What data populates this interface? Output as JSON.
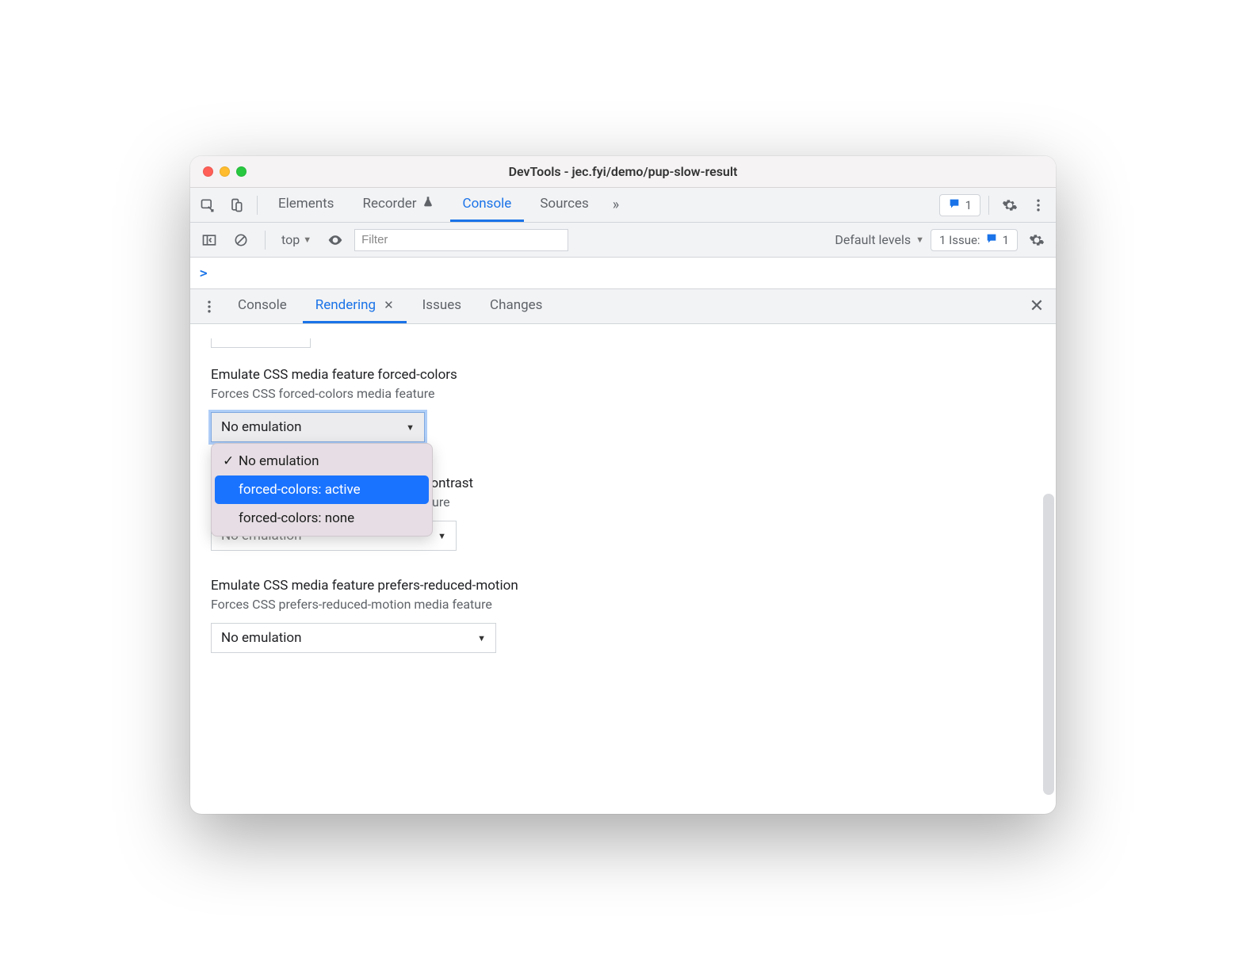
{
  "window": {
    "title": "DevTools - jec.fyi/demo/pup-slow-result"
  },
  "main_tabs": {
    "elements": "Elements",
    "recorder": "Recorder",
    "console": "Console",
    "sources": "Sources"
  },
  "issue_badge": {
    "count": "1"
  },
  "console_toolbar": {
    "context": "top",
    "filter_placeholder": "Filter",
    "levels": "Default levels",
    "issues_label": "1 Issue:",
    "issues_count": "1"
  },
  "console_prompt": ">",
  "drawer_tabs": {
    "console": "Console",
    "rendering": "Rendering",
    "issues": "Issues",
    "changes": "Changes"
  },
  "panel": {
    "group1": {
      "title": "Emulate CSS media feature forced-colors",
      "sub": "Forces CSS forced-colors media feature",
      "value": "No emulation",
      "options": {
        "opt0": "No emulation",
        "opt1": "forced-colors: active",
        "opt2": "forced-colors: none"
      }
    },
    "group2": {
      "title_partial": "e prefers-contrast",
      "sub_partial": "t media feature",
      "value": "No emulation"
    },
    "group3": {
      "title": "Emulate CSS media feature prefers-reduced-motion",
      "sub": "Forces CSS prefers-reduced-motion media feature",
      "value": "No emulation"
    }
  }
}
